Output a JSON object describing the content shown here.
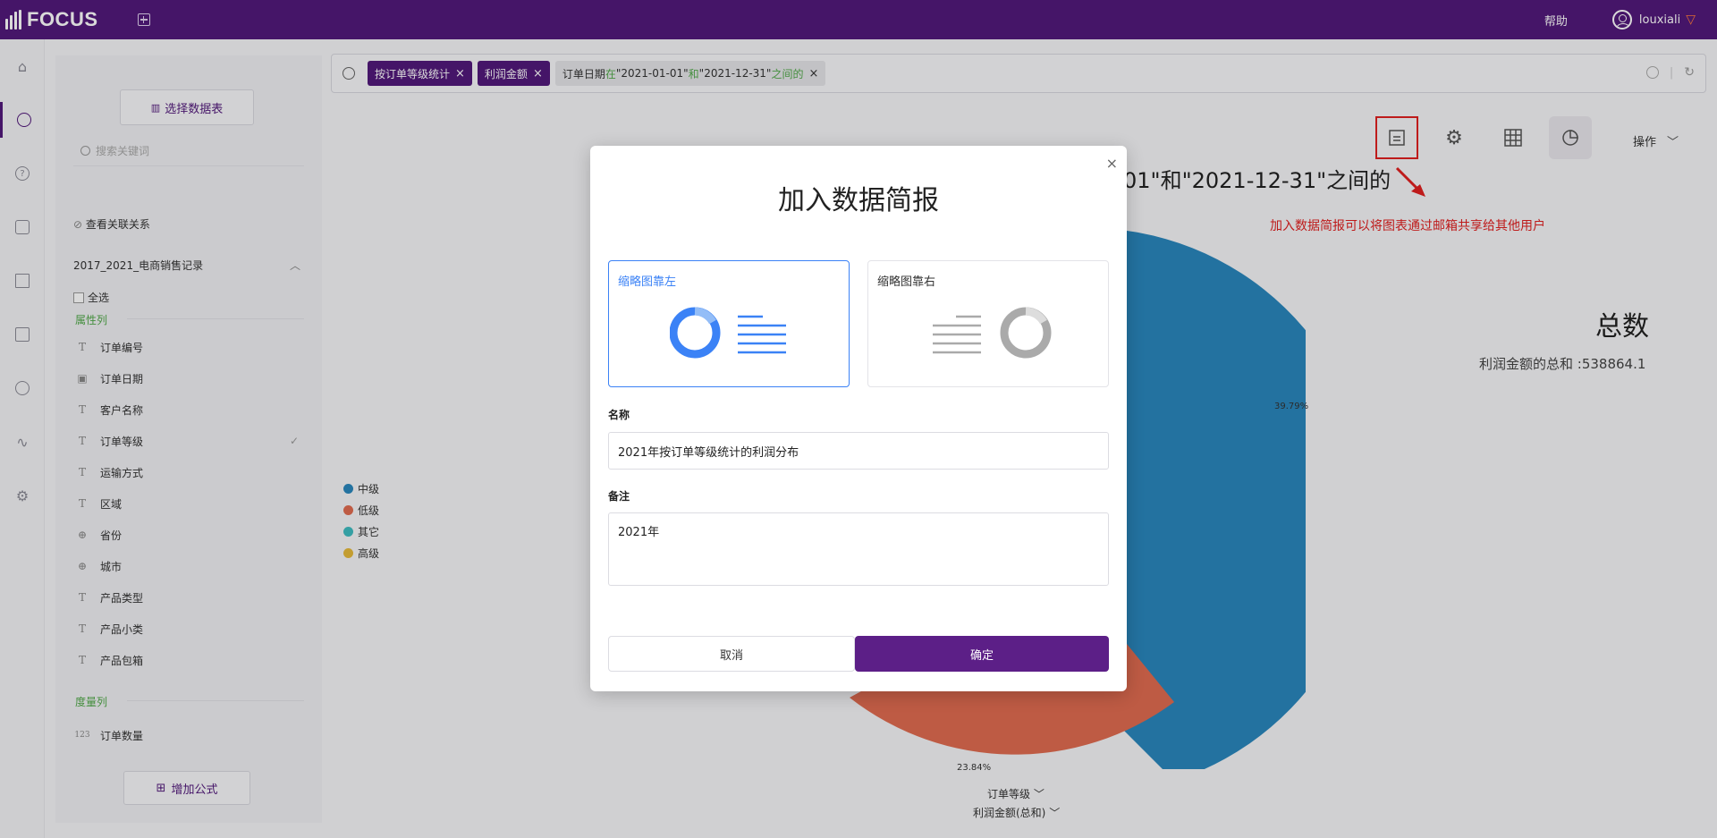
{
  "topbar": {
    "brand": "FOCUS",
    "help": "帮助",
    "username": "louxiali",
    "vip_icon": "diamond-icon"
  },
  "rail": {
    "items": [
      "home-icon",
      "search-icon",
      "question-icon",
      "presentation-icon",
      "table-icon",
      "folder-icon",
      "user-icon",
      "pulse-icon",
      "gear-icon"
    ]
  },
  "datapanel": {
    "select_table": "选择数据表",
    "search_placeholder": "搜索关键词",
    "view_relations": "查看关联关系",
    "table_name": "2017_2021_电商销售记录",
    "select_all": "全选",
    "attr_section": "属性列",
    "attr_fields": [
      {
        "type": "T",
        "name": "订单编号"
      },
      {
        "type": "▣",
        "name": "订单日期"
      },
      {
        "type": "T",
        "name": "客户名称"
      },
      {
        "type": "T",
        "name": "订单等级"
      },
      {
        "type": "T",
        "name": "运输方式"
      },
      {
        "type": "T",
        "name": "区域"
      },
      {
        "type": "⊕",
        "name": "省份"
      },
      {
        "type": "⊕",
        "name": "城市"
      },
      {
        "type": "T",
        "name": "产品类型"
      },
      {
        "type": "T",
        "name": "产品小类"
      },
      {
        "type": "T",
        "name": "产品包箱"
      }
    ],
    "measure_section": "度量列",
    "measure_fields": [
      {
        "type": "123",
        "name": "订单数量"
      }
    ],
    "add_formula": "增加公式"
  },
  "search": {
    "tokens": [
      "按订单等级统计",
      "利润金额"
    ],
    "filter": {
      "p1": "订单日期",
      "k1": "在",
      "p2": "\"2021-01-01\"",
      "k2": "和",
      "p3": "\"2021-12-31\"",
      "k3": "之间的"
    }
  },
  "toolbar": {
    "ops_label": "操作"
  },
  "chart": {
    "title_fragment": "01\"和\"2021-12-31\"之间的",
    "annotation": "加入数据简报可以将图表通过邮箱共享给其他用户",
    "total_label": "总数",
    "total_value": "利润金额的总和 :538864.1",
    "x_control": "订单等级",
    "y_control": "利润金额(总和)"
  },
  "chart_data": {
    "type": "pie",
    "categories": [
      "中级",
      "低级",
      "其它",
      "高级"
    ],
    "colors": [
      "#2a86bc",
      "#e06c50",
      "#3fbbc0",
      "#e6b93a"
    ],
    "labels_visible": {
      "中级": "39.79%",
      "低级": "23.84%"
    }
  },
  "modal": {
    "title": "加入数据简报",
    "layout_left": "缩略图靠左",
    "layout_right": "缩略图靠右",
    "name_label": "名称",
    "name_value": "2021年按订单等级统计的利润分布",
    "note_label": "备注",
    "note_value": "2021年",
    "cancel": "取消",
    "ok": "确定"
  }
}
